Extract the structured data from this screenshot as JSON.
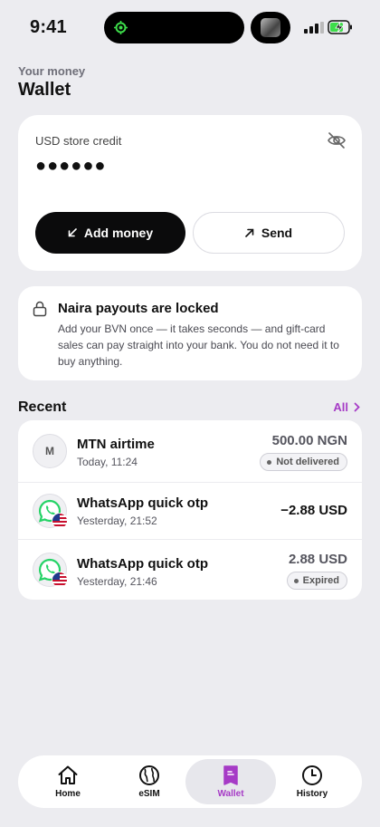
{
  "status_bar": {
    "time": "9:41"
  },
  "header": {
    "eyebrow": "Your money",
    "title": "Wallet"
  },
  "balance": {
    "label": "USD store credit",
    "masked_value": "●●●●●●",
    "add_label": "Add money",
    "send_label": "Send"
  },
  "locked": {
    "title": "Naira payouts are locked",
    "body": "Add your BVN once — it takes seconds — and gift-card sales can pay straight into your bank. You do not need it to buy anything."
  },
  "recent": {
    "title": "Recent",
    "all_label": "All",
    "items": [
      {
        "avatar": "M",
        "name": "MTN airtime",
        "time": "Today, 11:24",
        "amount": "500.00 NGN",
        "status": "Not delivered"
      },
      {
        "name": "WhatsApp quick otp",
        "time": "Yesterday, 21:52",
        "amount": "−2.88 USD"
      },
      {
        "name": "WhatsApp quick otp",
        "time": "Yesterday, 21:46",
        "amount": "2.88 USD",
        "status": "Expired"
      }
    ]
  },
  "tabs": [
    {
      "label": "Home",
      "icon": "home-icon"
    },
    {
      "label": "eSIM",
      "icon": "globe-icon"
    },
    {
      "label": "Wallet",
      "icon": "wallet-icon",
      "active": true
    },
    {
      "label": "History",
      "icon": "clock-icon"
    }
  ],
  "colors": {
    "accent": "#a63bc6",
    "background": "#ececf0",
    "whatsapp": "#25d366"
  }
}
